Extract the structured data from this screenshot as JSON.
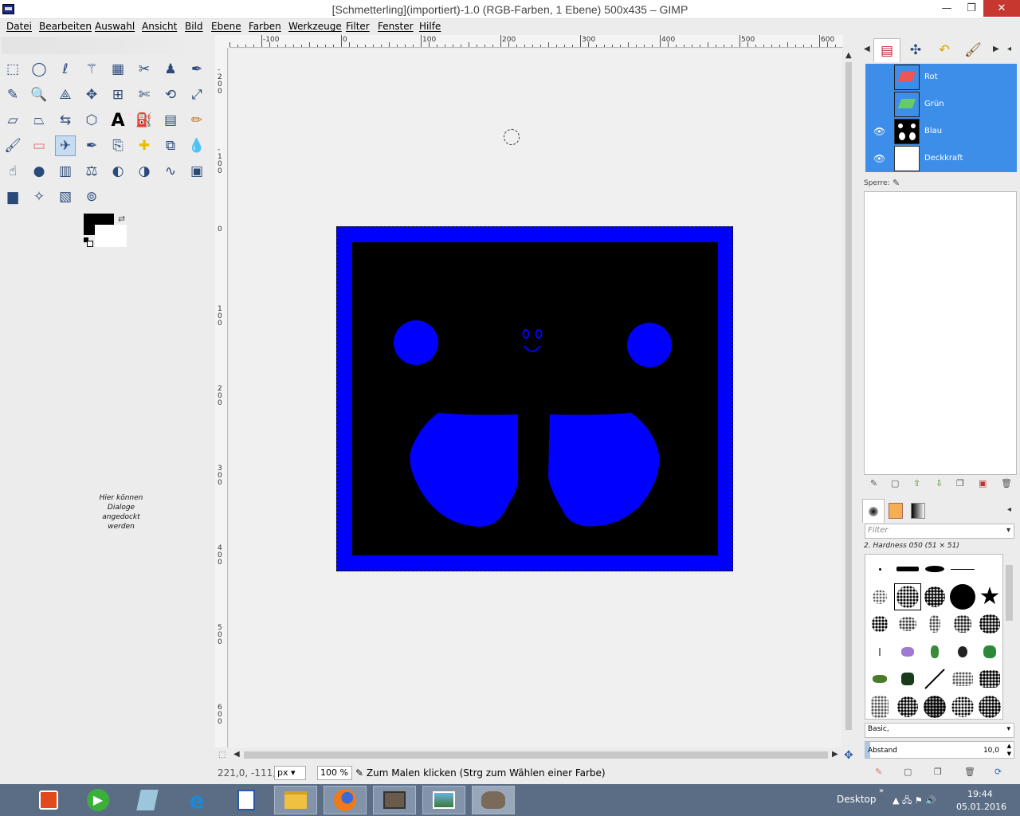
{
  "window": {
    "title": "[Schmetterling](importiert)-1.0 (RGB-Farben, 1 Ebene) 500x435 – GIMP",
    "minimize": "—",
    "maximize": "❐",
    "close": "✕"
  },
  "menu": [
    "Datei",
    "Bearbeiten",
    "Auswahl",
    "Ansicht",
    "Bild",
    "Ebene",
    "Farben",
    "Werkzeuge",
    "Filter",
    "Fenster",
    "Hilfe"
  ],
  "toolbox": {
    "tools": [
      "rect-select-icon",
      "ellipse-select-icon",
      "free-select-icon",
      "fuzzy-select-icon",
      "select-by-color-icon",
      "scissors-select-icon",
      "foreground-select-icon",
      "paths-icon",
      "color-picker-icon",
      "zoom-icon",
      "measure-icon",
      "move-icon",
      "align-icon",
      "crop-icon",
      "rotate-icon",
      "scale-icon",
      "shear-icon",
      "perspective-icon",
      "flip-icon",
      "cage-transform-icon",
      "text-icon",
      "bucket-fill-icon",
      "blend-icon",
      "pencil-icon",
      "paintbrush-icon",
      "eraser-icon",
      "airbrush-icon",
      "ink-icon",
      "clone-icon",
      "heal-icon",
      "perspective-clone-icon",
      "blur-icon",
      "smudge-icon",
      "dodge-burn-icon",
      "levels-icon",
      "color-balance-icon",
      "hue-saturation-icon",
      "threshold-icon",
      "curves-icon",
      "colorize-icon",
      "histogram-icon",
      "gegl-icon",
      "gradient-map-icon",
      "spiral-icon"
    ],
    "active_tool": "airbrush-icon",
    "fg_color": "#000000",
    "bg_color": "#ffffff",
    "dock_hint": "Hier können Dialoge angedockt werden"
  },
  "rulers": {
    "horizontal_labels": [
      "-100",
      "0",
      "100",
      "200",
      "300",
      "400",
      "500",
      "600"
    ],
    "vertical_labels": [
      "-200",
      "-100",
      "0",
      "100",
      "200",
      "300",
      "400",
      "500",
      "600"
    ]
  },
  "image": {
    "border_color": "#0000ff",
    "inner_color": "#000000",
    "shape_color": "#0000ff",
    "width": 500,
    "height": 435
  },
  "status": {
    "coords": "221,0, -111,0",
    "unit": "px",
    "zoom": "100 %",
    "message": "Zum Malen klicken (Strg zum Wählen einer Farbe)"
  },
  "dock": {
    "tabs": [
      "layers-icon",
      "paths-icon",
      "undo-icon",
      "brush-icon"
    ],
    "channels": [
      {
        "name": "Rot",
        "visible": false,
        "thumb": "red-channel"
      },
      {
        "name": "Grün",
        "visible": false,
        "thumb": "green-channel"
      },
      {
        "name": "Blau",
        "visible": true,
        "thumb": "blue-channel"
      },
      {
        "name": "Deckkraft",
        "visible": true,
        "thumb": "alpha-channel"
      }
    ],
    "lock_label": "Sperre:",
    "brush_filter_placeholder": "Filter",
    "brush_name": "2. Hardness 050 (51 × 51)",
    "preset": "Basic,",
    "spacing_label": "Abstand",
    "spacing_value": "10,0"
  },
  "taskbar": {
    "apps": [
      "office-icon",
      "media-player-icon",
      "notes-icon",
      "internet-explorer-icon",
      "word-icon",
      "file-explorer-icon",
      "firefox-icon",
      "video-editor-icon",
      "photo-viewer-icon",
      "gimp-icon"
    ],
    "active": "gimp-icon",
    "desktop_label": "Desktop",
    "time": "19:44",
    "date": "05.01.2016"
  }
}
